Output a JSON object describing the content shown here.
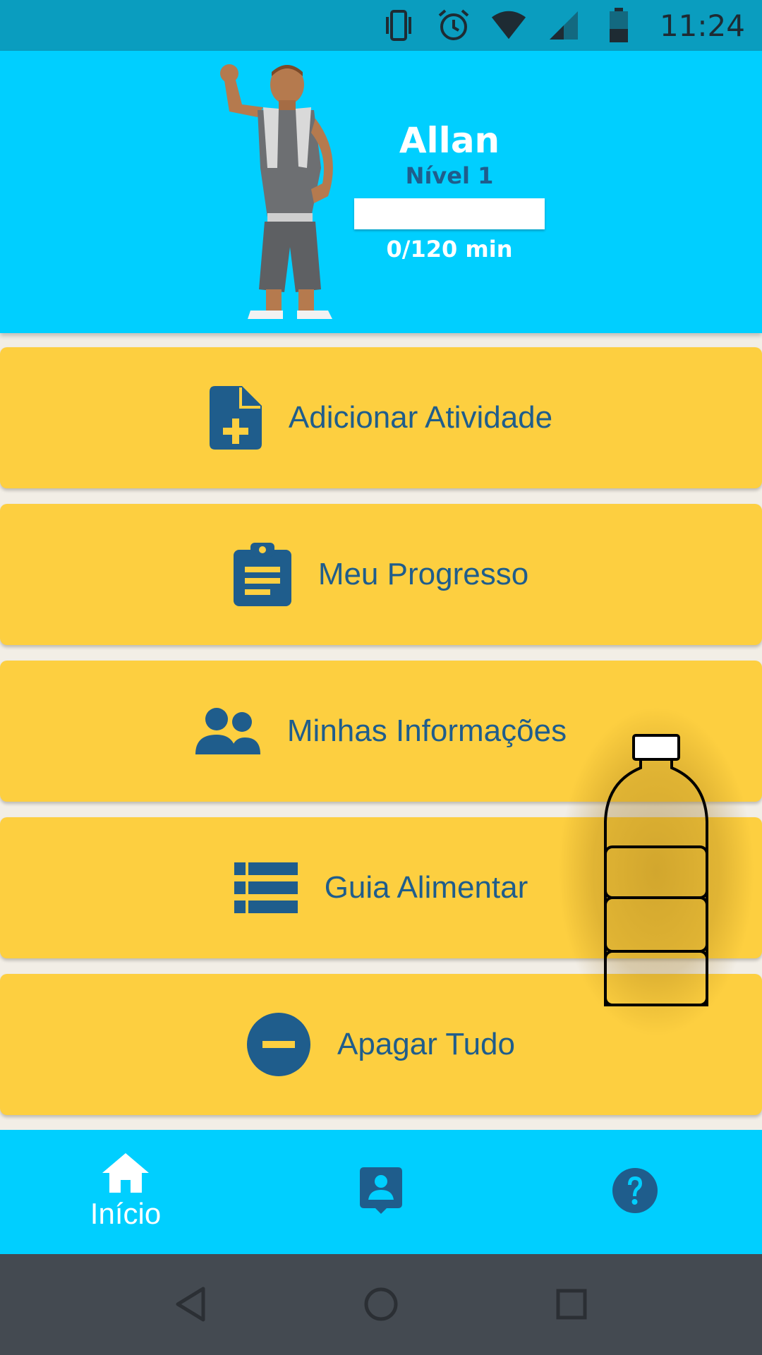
{
  "status_bar": {
    "time": "11:24",
    "icons": [
      "vibrate-icon",
      "alarm-icon",
      "wifi-icon",
      "signal-icon",
      "battery-icon"
    ]
  },
  "profile": {
    "name": "Allan",
    "level": "Nível 1",
    "progress_text": "0/120 min",
    "progress_fraction": 0
  },
  "menu": {
    "items": [
      {
        "label": "Adicionar Atividade",
        "icon": "add-document-icon"
      },
      {
        "label": "Meu Progresso",
        "icon": "clipboard-icon"
      },
      {
        "label": "Minhas Informações",
        "icon": "people-icon"
      },
      {
        "label": "Guia Alimentar",
        "icon": "list-icon"
      },
      {
        "label": "Apagar Tudo",
        "icon": "minus-circle-icon"
      }
    ]
  },
  "water_widget": {
    "icon": "water-bottle-icon"
  },
  "bottom_nav": {
    "items": [
      {
        "label": "Início",
        "icon": "home-icon",
        "active": true
      },
      {
        "label": "",
        "icon": "contact-card-icon",
        "active": false
      },
      {
        "label": "",
        "icon": "help-icon",
        "active": false
      }
    ]
  },
  "colors": {
    "header": "#00cfff",
    "card": "#fdcf40",
    "accent": "#1f5d8c",
    "status_bar": "#0a9dbf",
    "system_nav": "#444a51"
  }
}
